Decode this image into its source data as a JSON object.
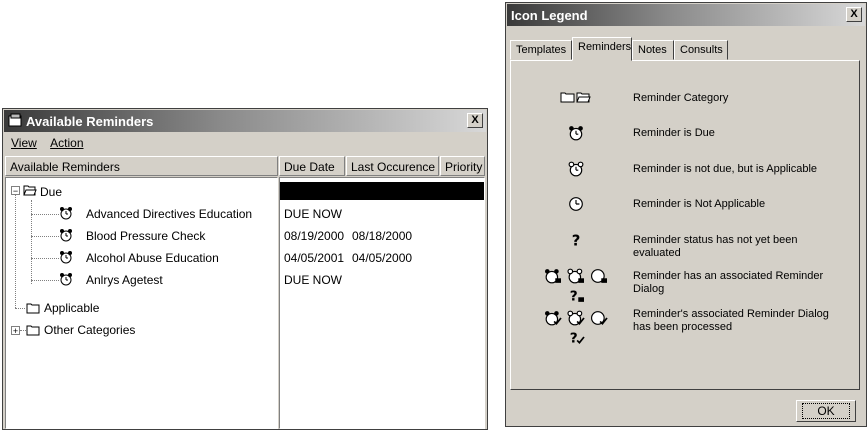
{
  "reminders_window": {
    "title": "Available Reminders",
    "close_label": "X",
    "menu": [
      "View",
      "Action"
    ],
    "columns": [
      "Available Reminders",
      "Due Date",
      "Last Occurence",
      "Priority"
    ],
    "tree": {
      "due_label": "Due",
      "expander_collapse": "−",
      "expander_expand": "+",
      "items": [
        {
          "label": "Advanced Directives Education",
          "due_date": "DUE NOW",
          "last": ""
        },
        {
          "label": "Blood Pressure Check",
          "due_date": "08/19/2000",
          "last": "08/18/2000"
        },
        {
          "label": "Alcohol Abuse Education",
          "due_date": "04/05/2001",
          "last": "04/05/2000"
        },
        {
          "label": "Anlrys Agetest",
          "due_date": "DUE NOW",
          "last": ""
        }
      ],
      "applicable_label": "Applicable",
      "other_label": "Other Categories"
    }
  },
  "legend_window": {
    "title": "Icon Legend",
    "close_label": "X",
    "tabs": [
      "Templates",
      "Reminders",
      "Notes",
      "Consults"
    ],
    "active_tab": "Reminders",
    "rows": [
      {
        "icons": [
          "folder-closed-icon",
          "folder-open-icon"
        ],
        "text": "Reminder Category"
      },
      {
        "icons": [
          "alarm-clock-icon"
        ],
        "text": "Reminder is Due"
      },
      {
        "icons": [
          "alarm-clock-outline-icon"
        ],
        "text": "Reminder is not due, but is Applicable"
      },
      {
        "icons": [
          "clock-icon"
        ],
        "text": "Reminder is Not Applicable"
      },
      {
        "icons": [
          "question-mark-icon"
        ],
        "text": "Reminder status has not yet been evaluated"
      },
      {
        "icons": [
          "alarm-dialog-icon",
          "alarm-dialog-outline-icon",
          "clock-dialog-icon",
          "question-dialog-icon"
        ],
        "text": "Reminder has an associated Reminder Dialog"
      },
      {
        "icons": [
          "alarm-processed-icon",
          "alarm-processed-outline-icon",
          "clock-processed-icon",
          "question-processed-icon"
        ],
        "text": "Reminder's associated Reminder Dialog has been processed"
      }
    ],
    "ok_label": "OK"
  }
}
